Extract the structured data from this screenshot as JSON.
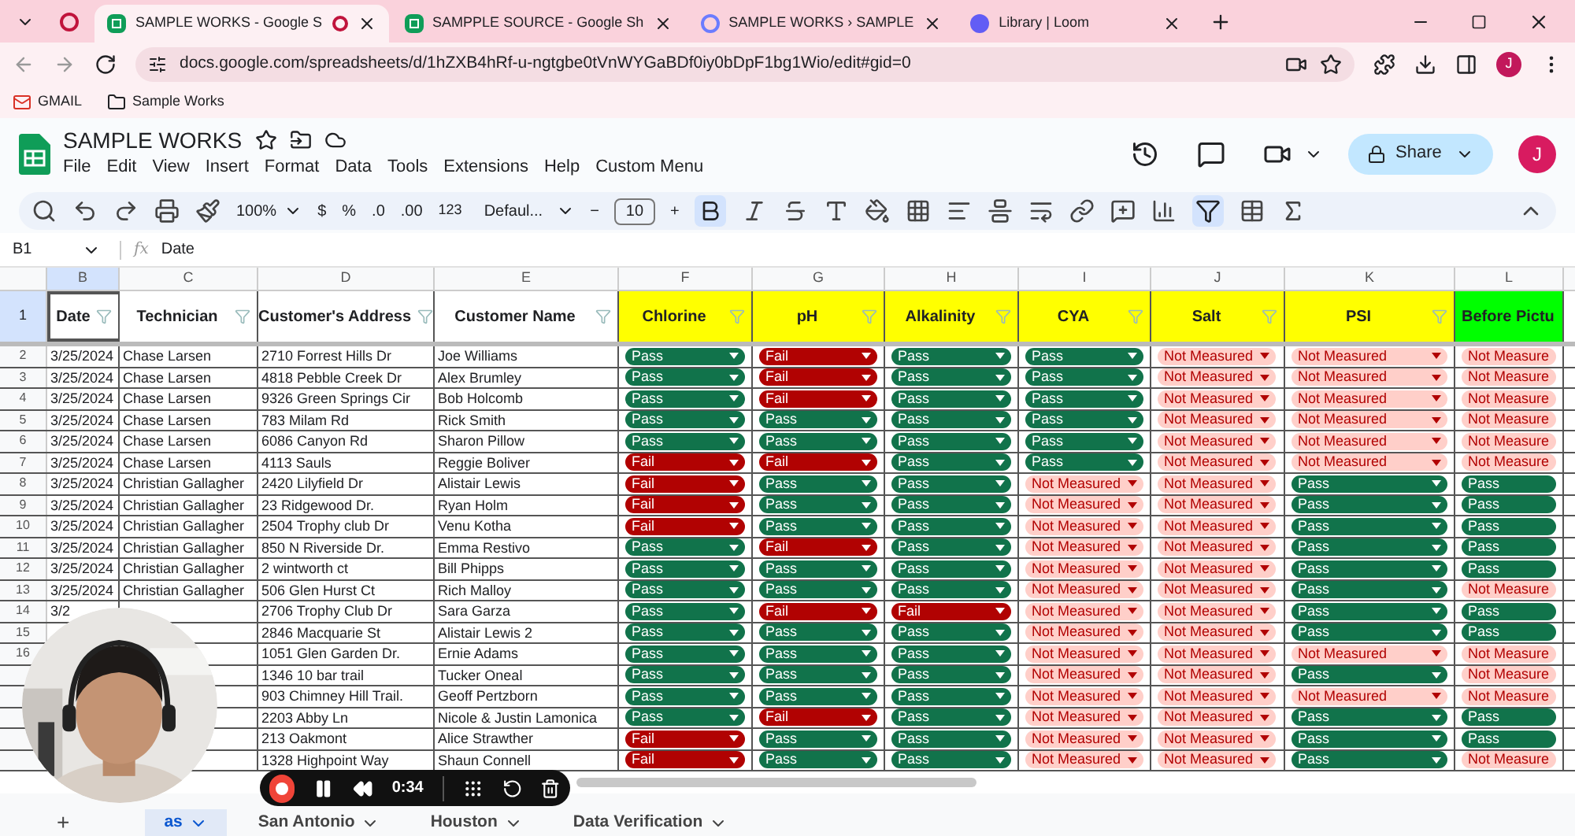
{
  "browser": {
    "tabs": [
      {
        "title": "SAMPLE WORKS - Google S",
        "kind": "sheets",
        "selected": true
      },
      {
        "title": "SAMPPLE SOURCE - Google Sh",
        "kind": "sheets",
        "selected": false
      },
      {
        "title": "SAMPLE WORKS › SAMPLE",
        "kind": "link",
        "selected": false
      },
      {
        "title": "Library | Loom",
        "kind": "loom",
        "selected": false
      }
    ],
    "url": "docs.google.com/spreadsheets/d/1hZXB4hRf-u-ngtgbe0tVnWYGaBDf0iy0bDpF1bg1Wio/edit#gid=0",
    "bookmarks": [
      {
        "label": "GMAIL",
        "kind": "mail"
      },
      {
        "label": "Sample Works",
        "kind": "folder"
      }
    ],
    "avatar": "J"
  },
  "app": {
    "title": "SAMPLE WORKS",
    "menu": [
      "File",
      "Edit",
      "View",
      "Insert",
      "Format",
      "Data",
      "Tools",
      "Extensions",
      "Help",
      "Custom Menu"
    ],
    "share": "Share",
    "avatar": "J",
    "zoom": "100%",
    "currency": "$",
    "percent": "%",
    "dec_less": ".0",
    "dec_more": ".00",
    "number_format": "123",
    "font": "Defaul...",
    "font_size": "10",
    "minus": "−",
    "plus": "+",
    "cell_ref": "B1",
    "function_label": "fx",
    "formula": "Date"
  },
  "sheet": {
    "letters": [
      "B",
      "C",
      "D",
      "E",
      "F",
      "G",
      "H",
      "I",
      "J",
      "K",
      "L"
    ],
    "headers": [
      {
        "text": "Date",
        "color": "#ffffff",
        "cut": false
      },
      {
        "text": "Technician",
        "color": "#ffffff",
        "cut": false
      },
      {
        "text": "Customer's Address",
        "color": "#ffffff",
        "cut": false
      },
      {
        "text": "Customer Name",
        "color": "#ffffff",
        "cut": false
      },
      {
        "text": "Chlorine",
        "color": "#ffff00",
        "cut": false
      },
      {
        "text": "pH",
        "color": "#ffff00",
        "cut": false
      },
      {
        "text": "Alkalinity",
        "color": "#ffff00",
        "cut": false
      },
      {
        "text": "CYA",
        "color": "#ffff00",
        "cut": false
      },
      {
        "text": "Salt",
        "color": "#ffff00",
        "cut": false
      },
      {
        "text": "PSI",
        "color": "#ffff00",
        "cut": false
      },
      {
        "text": "Before Pictu",
        "color": "#00ff00",
        "cut": true
      }
    ],
    "header_row": "1",
    "rows": [
      {
        "num": "2",
        "date": "3/25/2024",
        "technician": "Chase Larsen",
        "address": "2710 Forrest Hills Dr",
        "customer": "Joe Williams",
        "checks": [
          {
            "kind": "pass",
            "text": "Pass"
          },
          {
            "kind": "fail",
            "text": "Fail"
          },
          {
            "kind": "pass",
            "text": "Pass"
          },
          {
            "kind": "pass",
            "text": "Pass"
          },
          {
            "kind": "nm",
            "text": "Not Measured"
          },
          {
            "kind": "nm",
            "text": "Not Measured"
          },
          {
            "kind": "nm",
            "text": "Not Measure"
          }
        ]
      },
      {
        "num": "3",
        "date": "3/25/2024",
        "technician": "Chase Larsen",
        "address": "4818 Pebble Creek Dr",
        "customer": "Alex Brumley",
        "checks": [
          {
            "kind": "pass",
            "text": "Pass"
          },
          {
            "kind": "fail",
            "text": "Fail"
          },
          {
            "kind": "pass",
            "text": "Pass"
          },
          {
            "kind": "pass",
            "text": "Pass"
          },
          {
            "kind": "nm",
            "text": "Not Measured"
          },
          {
            "kind": "nm",
            "text": "Not Measured"
          },
          {
            "kind": "nm",
            "text": "Not Measure"
          }
        ]
      },
      {
        "num": "4",
        "date": "3/25/2024",
        "technician": "Chase Larsen",
        "address": "9326 Green Springs Cir",
        "customer": "Bob Holcomb",
        "checks": [
          {
            "kind": "pass",
            "text": "Pass"
          },
          {
            "kind": "fail",
            "text": "Fail"
          },
          {
            "kind": "pass",
            "text": "Pass"
          },
          {
            "kind": "pass",
            "text": "Pass"
          },
          {
            "kind": "nm",
            "text": "Not Measured"
          },
          {
            "kind": "nm",
            "text": "Not Measured"
          },
          {
            "kind": "nm",
            "text": "Not Measure"
          }
        ]
      },
      {
        "num": "5",
        "date": "3/25/2024",
        "technician": "Chase Larsen",
        "address": "783 Milam Rd",
        "customer": "Rick Smith",
        "checks": [
          {
            "kind": "pass",
            "text": "Pass"
          },
          {
            "kind": "pass",
            "text": "Pass"
          },
          {
            "kind": "pass",
            "text": "Pass"
          },
          {
            "kind": "pass",
            "text": "Pass"
          },
          {
            "kind": "nm",
            "text": "Not Measured"
          },
          {
            "kind": "nm",
            "text": "Not Measured"
          },
          {
            "kind": "nm",
            "text": "Not Measure"
          }
        ]
      },
      {
        "num": "6",
        "date": "3/25/2024",
        "technician": "Chase Larsen",
        "address": "6086 Canyon Rd",
        "customer": "Sharon Pillow",
        "checks": [
          {
            "kind": "pass",
            "text": "Pass"
          },
          {
            "kind": "pass",
            "text": "Pass"
          },
          {
            "kind": "pass",
            "text": "Pass"
          },
          {
            "kind": "pass",
            "text": "Pass"
          },
          {
            "kind": "nm",
            "text": "Not Measured"
          },
          {
            "kind": "nm",
            "text": "Not Measured"
          },
          {
            "kind": "nm",
            "text": "Not Measure"
          }
        ]
      },
      {
        "num": "7",
        "date": "3/25/2024",
        "technician": "Chase Larsen",
        "address": "4113 Sauls",
        "customer": "Reggie Boliver",
        "checks": [
          {
            "kind": "fail",
            "text": "Fail"
          },
          {
            "kind": "fail",
            "text": "Fail"
          },
          {
            "kind": "pass",
            "text": "Pass"
          },
          {
            "kind": "pass",
            "text": "Pass"
          },
          {
            "kind": "nm",
            "text": "Not Measured"
          },
          {
            "kind": "nm",
            "text": "Not Measured"
          },
          {
            "kind": "nm",
            "text": "Not Measure"
          }
        ]
      },
      {
        "num": "8",
        "date": "3/25/2024",
        "technician": "Christian Gallagher",
        "address": "2420 Lilyfield Dr",
        "customer": "Alistair Lewis",
        "checks": [
          {
            "kind": "fail",
            "text": "Fail"
          },
          {
            "kind": "pass",
            "text": "Pass"
          },
          {
            "kind": "pass",
            "text": "Pass"
          },
          {
            "kind": "nm",
            "text": "Not Measured"
          },
          {
            "kind": "nm",
            "text": "Not Measured"
          },
          {
            "kind": "pass",
            "text": "Pass"
          },
          {
            "kind": "pass",
            "text": "Pass"
          }
        ]
      },
      {
        "num": "9",
        "date": "3/25/2024",
        "technician": "Christian Gallagher",
        "address": "23 Ridgewood Dr.",
        "customer": "Ryan Holm",
        "checks": [
          {
            "kind": "fail",
            "text": "Fail"
          },
          {
            "kind": "pass",
            "text": "Pass"
          },
          {
            "kind": "pass",
            "text": "Pass"
          },
          {
            "kind": "nm",
            "text": "Not Measured"
          },
          {
            "kind": "nm",
            "text": "Not Measured"
          },
          {
            "kind": "pass",
            "text": "Pass"
          },
          {
            "kind": "pass",
            "text": "Pass"
          }
        ]
      },
      {
        "num": "10",
        "date": "3/25/2024",
        "technician": "Christian Gallagher",
        "address": "2504 Trophy club Dr",
        "customer": "Venu Kotha",
        "checks": [
          {
            "kind": "fail",
            "text": "Fail"
          },
          {
            "kind": "pass",
            "text": "Pass"
          },
          {
            "kind": "pass",
            "text": "Pass"
          },
          {
            "kind": "nm",
            "text": "Not Measured"
          },
          {
            "kind": "nm",
            "text": "Not Measured"
          },
          {
            "kind": "pass",
            "text": "Pass"
          },
          {
            "kind": "pass",
            "text": "Pass"
          }
        ]
      },
      {
        "num": "11",
        "date": "3/25/2024",
        "technician": "Christian Gallagher",
        "address": "850 N Riverside Dr.",
        "customer": "Emma Restivo",
        "checks": [
          {
            "kind": "pass",
            "text": "Pass"
          },
          {
            "kind": "fail",
            "text": "Fail"
          },
          {
            "kind": "pass",
            "text": "Pass"
          },
          {
            "kind": "nm",
            "text": "Not Measured"
          },
          {
            "kind": "nm",
            "text": "Not Measured"
          },
          {
            "kind": "pass",
            "text": "Pass"
          },
          {
            "kind": "pass",
            "text": "Pass"
          }
        ]
      },
      {
        "num": "12",
        "date": "3/25/2024",
        "technician": "Christian Gallagher",
        "address": "2 wintworth ct",
        "customer": "Bill Phipps",
        "checks": [
          {
            "kind": "pass",
            "text": "Pass"
          },
          {
            "kind": "pass",
            "text": "Pass"
          },
          {
            "kind": "pass",
            "text": "Pass"
          },
          {
            "kind": "nm",
            "text": "Not Measured"
          },
          {
            "kind": "nm",
            "text": "Not Measured"
          },
          {
            "kind": "pass",
            "text": "Pass"
          },
          {
            "kind": "pass",
            "text": "Pass"
          }
        ]
      },
      {
        "num": "13",
        "date": "3/25/2024",
        "technician": "Christian Gallagher",
        "address": "506 Glen Hurst Ct",
        "customer": "Rich Malloy",
        "checks": [
          {
            "kind": "pass",
            "text": "Pass"
          },
          {
            "kind": "pass",
            "text": "Pass"
          },
          {
            "kind": "pass",
            "text": "Pass"
          },
          {
            "kind": "nm",
            "text": "Not Measured"
          },
          {
            "kind": "nm",
            "text": "Not Measured"
          },
          {
            "kind": "pass",
            "text": "Pass"
          },
          {
            "kind": "nm",
            "text": "Not Measure"
          }
        ]
      },
      {
        "num": "14",
        "date": "3/2",
        "address": "2706 Trophy Club Dr",
        "customer": "Sara Garza",
        "checks": [
          {
            "kind": "pass",
            "text": "Pass"
          },
          {
            "kind": "fail",
            "text": "Fail"
          },
          {
            "kind": "fail",
            "text": "Fail"
          },
          {
            "kind": "nm",
            "text": "Not Measured"
          },
          {
            "kind": "nm",
            "text": "Not Measured"
          },
          {
            "kind": "pass",
            "text": "Pass"
          },
          {
            "kind": "pass",
            "text": "Pass"
          }
        ]
      },
      {
        "num": "15",
        "address": "2846 Macquarie St",
        "customer": "Alistair  Lewis 2",
        "checks": [
          {
            "kind": "pass",
            "text": "Pass"
          },
          {
            "kind": "pass",
            "text": "Pass"
          },
          {
            "kind": "pass",
            "text": "Pass"
          },
          {
            "kind": "nm",
            "text": "Not Measured"
          },
          {
            "kind": "nm",
            "text": "Not Measured"
          },
          {
            "kind": "pass",
            "text": "Pass"
          },
          {
            "kind": "pass",
            "text": "Pass"
          }
        ]
      },
      {
        "num": "16",
        "address": "1051 Glen Garden Dr.",
        "customer": "Ernie Adams",
        "checks": [
          {
            "kind": "pass",
            "text": "Pass"
          },
          {
            "kind": "pass",
            "text": "Pass"
          },
          {
            "kind": "pass",
            "text": "Pass"
          },
          {
            "kind": "nm",
            "text": "Not Measured"
          },
          {
            "kind": "nm",
            "text": "Not Measured"
          },
          {
            "kind": "nm",
            "text": "Not Measured"
          },
          {
            "kind": "nm",
            "text": "Not Measure"
          }
        ]
      },
      {
        "address": "1346 10 bar trail",
        "customer": "Tucker Oneal",
        "checks": [
          {
            "kind": "pass",
            "text": "Pass"
          },
          {
            "kind": "pass",
            "text": "Pass"
          },
          {
            "kind": "pass",
            "text": "Pass"
          },
          {
            "kind": "nm",
            "text": "Not Measured"
          },
          {
            "kind": "nm",
            "text": "Not Measured"
          },
          {
            "kind": "pass",
            "text": "Pass"
          },
          {
            "kind": "nm",
            "text": "Not Measure"
          }
        ]
      },
      {
        "address": "903 Chimney Hill Trail.",
        "customer": "Geoff Pertzborn",
        "checks": [
          {
            "kind": "pass",
            "text": "Pass"
          },
          {
            "kind": "pass",
            "text": "Pass"
          },
          {
            "kind": "pass",
            "text": "Pass"
          },
          {
            "kind": "nm",
            "text": "Not Measured"
          },
          {
            "kind": "nm",
            "text": "Not Measured"
          },
          {
            "kind": "nm",
            "text": "Not Measured"
          },
          {
            "kind": "nm",
            "text": "Not Measure"
          }
        ]
      },
      {
        "address": "2203 Abby Ln",
        "customer": "Nicole & Justin Lamonica",
        "checks": [
          {
            "kind": "pass",
            "text": "Pass"
          },
          {
            "kind": "fail",
            "text": "Fail"
          },
          {
            "kind": "pass",
            "text": "Pass"
          },
          {
            "kind": "nm",
            "text": "Not Measured"
          },
          {
            "kind": "nm",
            "text": "Not Measured"
          },
          {
            "kind": "pass",
            "text": "Pass"
          },
          {
            "kind": "pass",
            "text": "Pass"
          }
        ]
      },
      {
        "address": "213 Oakmont",
        "customer": "Alice Strawther",
        "checks": [
          {
            "kind": "fail",
            "text": "Fail"
          },
          {
            "kind": "pass",
            "text": "Pass"
          },
          {
            "kind": "pass",
            "text": "Pass"
          },
          {
            "kind": "nm",
            "text": "Not Measured"
          },
          {
            "kind": "nm",
            "text": "Not Measured"
          },
          {
            "kind": "pass",
            "text": "Pass"
          },
          {
            "kind": "pass",
            "text": "Pass"
          }
        ]
      },
      {
        "address": "1328 Highpoint Way",
        "customer": "Shaun Connell",
        "checks": [
          {
            "kind": "fail",
            "text": "Fail"
          },
          {
            "kind": "pass",
            "text": "Pass"
          },
          {
            "kind": "pass",
            "text": "Pass"
          },
          {
            "kind": "nm",
            "text": "Not Measured"
          },
          {
            "kind": "nm",
            "text": "Not Measured"
          },
          {
            "kind": "pass",
            "text": "Pass"
          },
          {
            "kind": "nm",
            "text": "Not Measure"
          }
        ]
      }
    ]
  },
  "sheet_tabs": {
    "add": "+",
    "tabs": [
      {
        "label": "as",
        "selected": true
      },
      {
        "label": "San Antonio",
        "selected": false
      },
      {
        "label": "Houston",
        "selected": false
      },
      {
        "label": "Data Verification",
        "selected": false
      }
    ]
  },
  "recorder": {
    "time": "0:34"
  }
}
